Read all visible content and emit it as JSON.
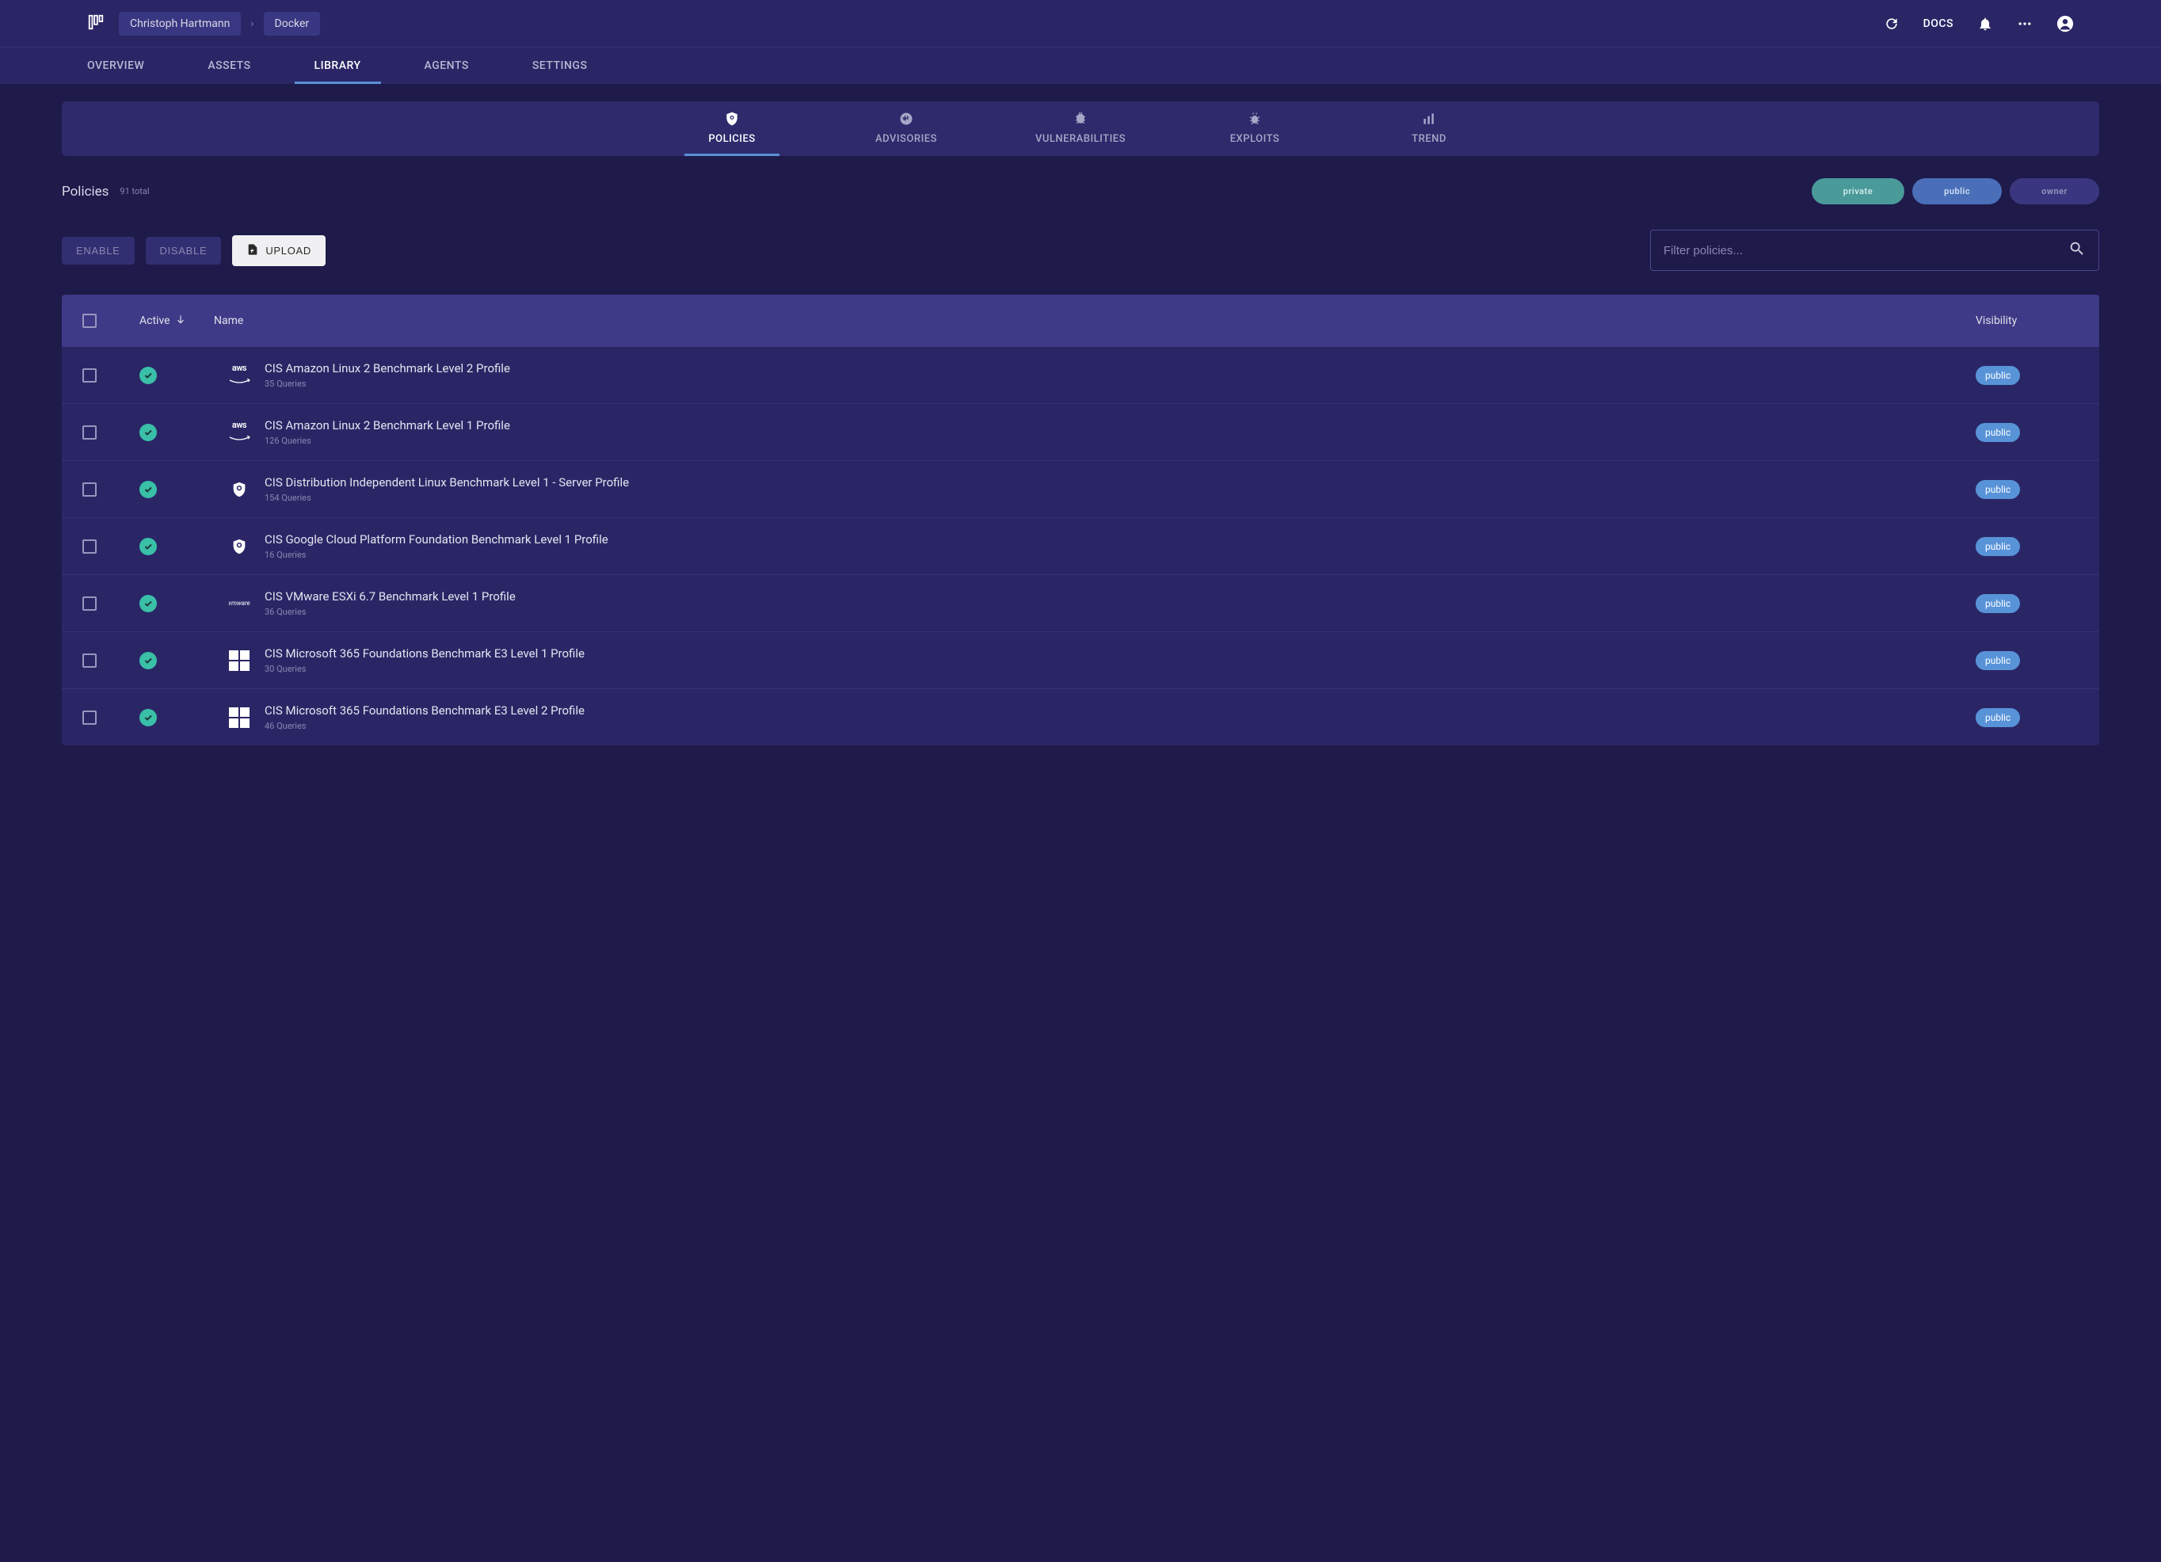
{
  "header": {
    "breadcrumb": {
      "user": "Christoph Hartmann",
      "context": "Docker"
    },
    "docs": "DOCS"
  },
  "topnav": {
    "items": [
      "OVERVIEW",
      "ASSETS",
      "LIBRARY",
      "AGENTS",
      "SETTINGS"
    ],
    "active": "LIBRARY"
  },
  "subtabs": {
    "items": [
      "POLICIES",
      "ADVISORIES",
      "VULNERABILITIES",
      "EXPLOITS",
      "TREND"
    ],
    "active": "POLICIES"
  },
  "page": {
    "title": "Policies",
    "totalText": "91 total"
  },
  "filters": {
    "private": "private",
    "public": "public",
    "owner": "owner"
  },
  "actions": {
    "enable": "ENABLE",
    "disable": "DISABLE",
    "upload": "UPLOAD"
  },
  "search": {
    "placeholder": "Filter policies..."
  },
  "table": {
    "headers": {
      "active": "Active",
      "name": "Name",
      "visibility": "Visibility"
    },
    "rows": [
      {
        "icon": "aws",
        "name": "CIS Amazon Linux 2 Benchmark Level 2 Profile",
        "sub": "35 Queries",
        "visibility": "public",
        "active": true
      },
      {
        "icon": "aws",
        "name": "CIS Amazon Linux 2 Benchmark Level 1 Profile",
        "sub": "126 Queries",
        "visibility": "public",
        "active": true
      },
      {
        "icon": "shield",
        "name": "CIS Distribution Independent Linux Benchmark Level 1 - Server Profile",
        "sub": "154 Queries",
        "visibility": "public",
        "active": true
      },
      {
        "icon": "shield",
        "name": "CIS Google Cloud Platform Foundation Benchmark Level 1 Profile",
        "sub": "16 Queries",
        "visibility": "public",
        "active": true
      },
      {
        "icon": "vmware",
        "name": "CIS VMware ESXi 6.7 Benchmark Level 1 Profile",
        "sub": "36 Queries",
        "visibility": "public",
        "active": true
      },
      {
        "icon": "ms",
        "name": "CIS Microsoft 365 Foundations Benchmark E3 Level 1 Profile",
        "sub": "30 Queries",
        "visibility": "public",
        "active": true
      },
      {
        "icon": "ms",
        "name": "CIS Microsoft 365 Foundations Benchmark E3 Level 2 Profile",
        "sub": "46 Queries",
        "visibility": "public",
        "active": true
      }
    ]
  }
}
